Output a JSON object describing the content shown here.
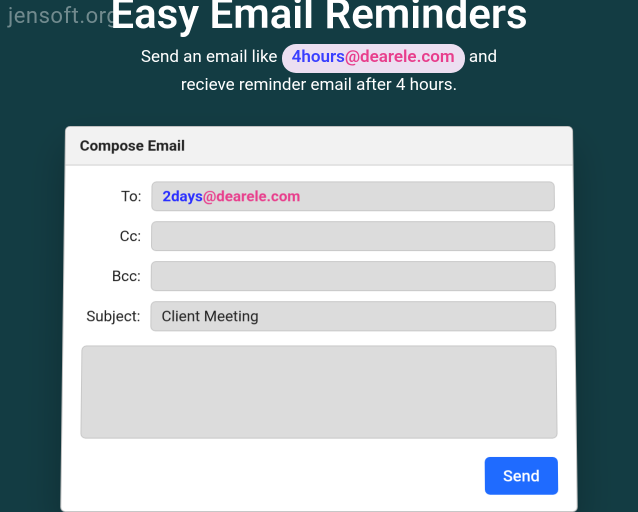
{
  "watermark": "jensoft.org",
  "hero": {
    "title": "Easy Email Reminders",
    "subtitle_before": "Send an email like ",
    "pill_part1": "4hours",
    "pill_part2": "@dearele.com",
    "subtitle_mid": " and",
    "subtitle_line2": "recieve reminder email after 4 hours."
  },
  "compose": {
    "header": "Compose Email",
    "labels": {
      "to": "To:",
      "cc": "Cc:",
      "bcc": "Bcc:",
      "subject": "Subject:"
    },
    "to_value_part1": "2days",
    "to_value_part2": "@dearele.com",
    "cc_value": "",
    "bcc_value": "",
    "subject_value": "Client Meeting",
    "body_value": "",
    "send_label": "Send"
  }
}
